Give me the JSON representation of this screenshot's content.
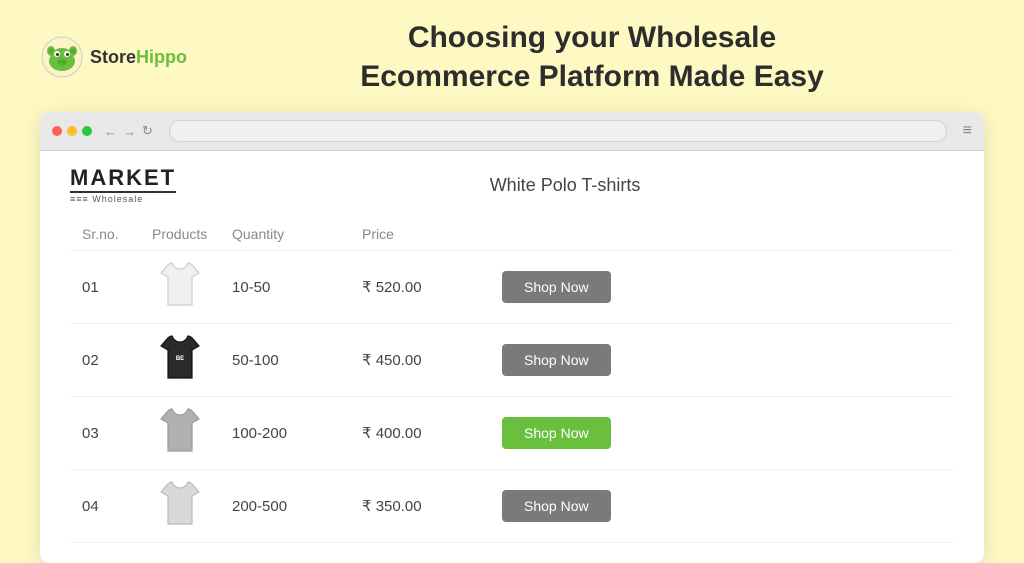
{
  "logo": {
    "store": "Store",
    "hippo": "Hippo",
    "alt": "StoreHippo logo"
  },
  "page_title": {
    "line1": "Choosing your Wholesale",
    "line2": "Ecommerce Platform Made Easy"
  },
  "browser": {
    "dots": [
      "red",
      "yellow",
      "green"
    ],
    "nav": [
      "←",
      "→",
      "↺"
    ]
  },
  "site": {
    "market_logo": "MARKET",
    "wholesale": "≡≡≡ Wholesale",
    "product_heading": "White Polo T-shirts"
  },
  "table": {
    "headers": [
      "Sr.no.",
      "Products",
      "Quantity",
      "Price",
      ""
    ],
    "rows": [
      {
        "sr": "01",
        "quantity": "10-50",
        "price": "₹ 520.00",
        "btn_label": "Shop Now",
        "btn_style": "gray",
        "tshirt_color": "white"
      },
      {
        "sr": "02",
        "quantity": "50-100",
        "price": "₹ 450.00",
        "btn_label": "Shop Now",
        "btn_style": "gray",
        "tshirt_color": "black"
      },
      {
        "sr": "03",
        "quantity": "100-200",
        "price": "₹ 400.00",
        "btn_label": "Shop Now",
        "btn_style": "green",
        "tshirt_color": "gray"
      },
      {
        "sr": "04",
        "quantity": "200-500",
        "price": "₹ 350.00",
        "btn_label": "Shop Now",
        "btn_style": "gray",
        "tshirt_color": "lightgray"
      }
    ]
  }
}
